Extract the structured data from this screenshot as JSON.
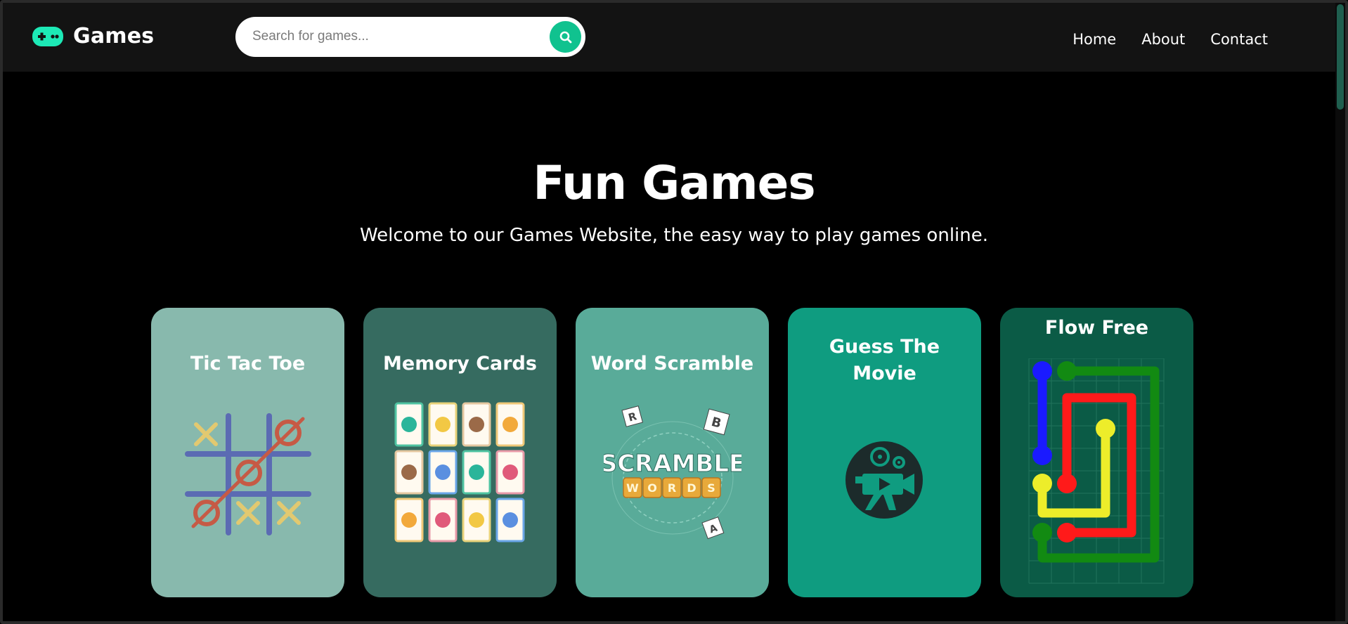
{
  "brand": {
    "name": "Games",
    "icon": "gamepad-icon",
    "accent": "#1de9b6"
  },
  "search": {
    "placeholder": "Search for games...",
    "icon": "search-icon",
    "button_color": "#10c28f"
  },
  "nav": {
    "items": [
      "Home",
      "About",
      "Contact"
    ]
  },
  "hero": {
    "title": "Fun Games",
    "subtitle": "Welcome to our Games Website, the easy way to play games online."
  },
  "cards": [
    {
      "title": "Tic Tac Toe",
      "color": "#88b9ad"
    },
    {
      "title": "Memory Cards",
      "color": "#366b60"
    },
    {
      "title": "Word Scramble",
      "color": "#59ab99"
    },
    {
      "title": "Guess The Movie",
      "color": "#0f9c80"
    },
    {
      "title": "Flow Free",
      "color": "#0b5b46"
    }
  ],
  "scramble_art": {
    "word1": "SCRAMBLE",
    "word2": "WORDS",
    "tiles": [
      "R",
      "B",
      "A"
    ]
  }
}
